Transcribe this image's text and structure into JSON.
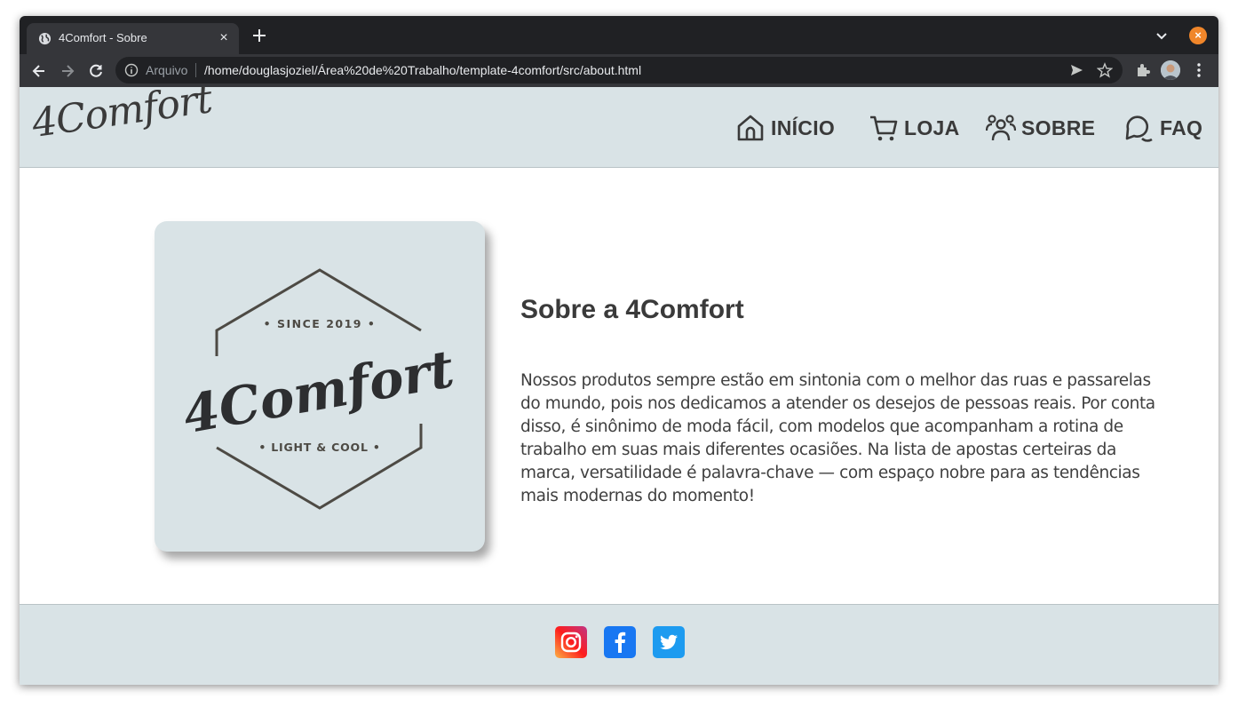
{
  "browser": {
    "tab_title": "4Comfort - Sobre",
    "tab_close": "×",
    "scheme_label": "Arquivo",
    "url": "/home/douglasjoziel/Área%20de%20Trabalho/template-4comfort/src/about.html",
    "close_glyph": "×"
  },
  "site": {
    "logo_text": "4Comfort",
    "nav": {
      "home": "INÍCIO",
      "shop": "LOJA",
      "about": "SOBRE",
      "faq": "FAQ"
    },
    "about": {
      "badge_top": "• SINCE 2019 •",
      "badge_brand": "4Comfort",
      "badge_bottom": "• LIGHT & COOL •",
      "title": "Sobre a 4Comfort",
      "body": "Nossos produtos sempre estão em sintonia com o melhor das ruas e passarelas do mundo, pois nos dedicamos a atender os desejos de pessoas reais. Por conta disso, é sinônimo de moda fácil, com modelos que acompanham a rotina de trabalho em suas mais diferentes ocasiões. Na lista de apostas certeiras da marca, versatilidade é palavra-chave — com espaço nobre para as tendências mais modernas do momento!"
    },
    "footer": {
      "social": [
        "instagram-icon",
        "facebook-icon",
        "twitter-icon"
      ]
    }
  },
  "colors": {
    "header_bg": "#d9e3e6",
    "text_dark": "#3a3a3a",
    "chrome_dark": "#202124",
    "chrome_toolbar": "#35363a"
  }
}
